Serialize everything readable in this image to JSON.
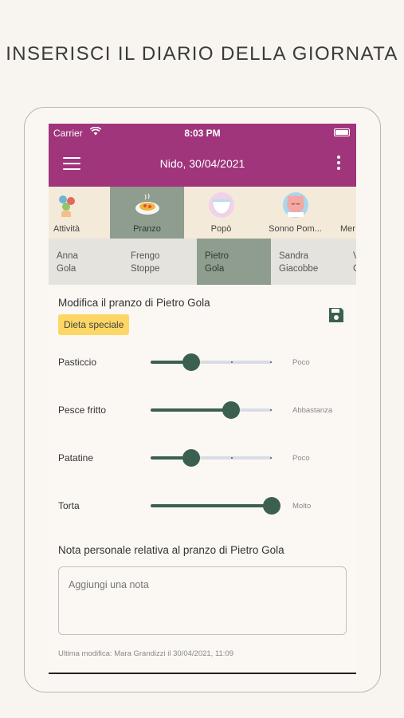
{
  "headline": "INSERISCI IL DIARIO DELLA GIORNATA",
  "status_bar": {
    "carrier": "Carrier",
    "time": "8:03 PM"
  },
  "app_bar": {
    "title": "Nido, 30/04/2021"
  },
  "categories": [
    {
      "label": "Attività",
      "icon": "balloons-icon",
      "selected": false
    },
    {
      "label": "Pranzo",
      "icon": "pasta-plate-icon",
      "selected": true
    },
    {
      "label": "Popò",
      "icon": "diaper-icon",
      "selected": false
    },
    {
      "label": "Sonno Pom...",
      "icon": "sleeping-baby-icon",
      "selected": false
    },
    {
      "label": "Mer",
      "icon": "snack-icon",
      "selected": false
    }
  ],
  "children": [
    {
      "first": "Anna",
      "last": "Gola",
      "selected": false
    },
    {
      "first": "Frengo",
      "last": "Stoppe",
      "selected": false
    },
    {
      "first": "Pietro",
      "last": "Gola",
      "selected": true
    },
    {
      "first": "Sandra",
      "last": "Giacobbe",
      "selected": false
    },
    {
      "first": "V",
      "last": "G",
      "selected": false
    }
  ],
  "form": {
    "title": "Modifica il pranzo di Pietro Gola",
    "badge": "Dieta speciale",
    "save_icon": "floppy-disk-icon"
  },
  "food_items": [
    {
      "name": "Pasticcio",
      "level": 1,
      "max": 3,
      "value_label": "Poco"
    },
    {
      "name": "Pesce fritto",
      "level": 2,
      "max": 3,
      "value_label": "Abbastanza"
    },
    {
      "name": "Patatine",
      "level": 1,
      "max": 3,
      "value_label": "Poco"
    },
    {
      "name": "Torta",
      "level": 3,
      "max": 3,
      "value_label": "Molto"
    }
  ],
  "note": {
    "title": "Nota personale relativa al pranzo di Pietro Gola",
    "placeholder": "Aggiungi una nota",
    "value": ""
  },
  "footer": "Ultima modifica: Mara Grandizzi il 30/04/2021, 11:09",
  "colors": {
    "primary": "#a0357c",
    "selected_tab": "#8e9d8d",
    "slider": "#3b6050",
    "badge": "#fcd765",
    "background": "#f8f4ef"
  }
}
